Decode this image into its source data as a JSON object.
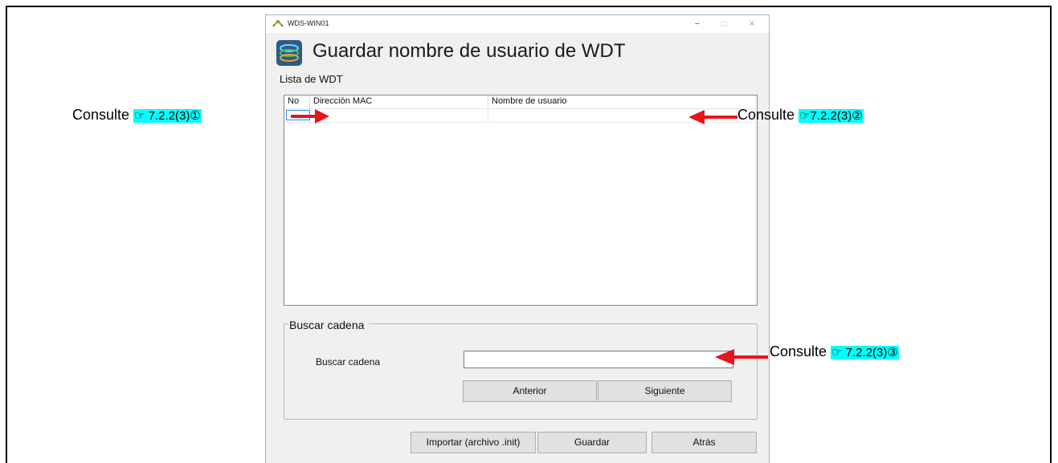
{
  "window": {
    "title": "WDS-WIN01",
    "min_glyph": "−",
    "max_glyph": "□",
    "close_glyph": "✕",
    "heading": "Guardar nombre de usuario de WDT",
    "list_label": "Lista de WDT"
  },
  "table": {
    "columns": [
      "No",
      "Dirección MAC",
      "Nombre de usuario"
    ],
    "rows": [
      [
        "",
        "",
        ""
      ]
    ]
  },
  "search": {
    "group_title": "Buscar cadena",
    "label": "Buscar cadena",
    "value": "",
    "prev_label": "Anterior",
    "next_label": "Siguiente"
  },
  "footer": {
    "import_label": "Importar (archivo .init)",
    "save_label": "Guardar",
    "back_label": "Atrás"
  },
  "annotations": [
    {
      "text": "Consulte",
      "ref": "☞ 7.2.2(3)①"
    },
    {
      "text": "Consulte",
      "ref": "☞7.2.2(3)②"
    },
    {
      "text": "Consulte",
      "ref": "☞ 7.2.2(3)③"
    }
  ],
  "colors": {
    "highlight": "#00ffff",
    "arrow": "#e8141b"
  }
}
